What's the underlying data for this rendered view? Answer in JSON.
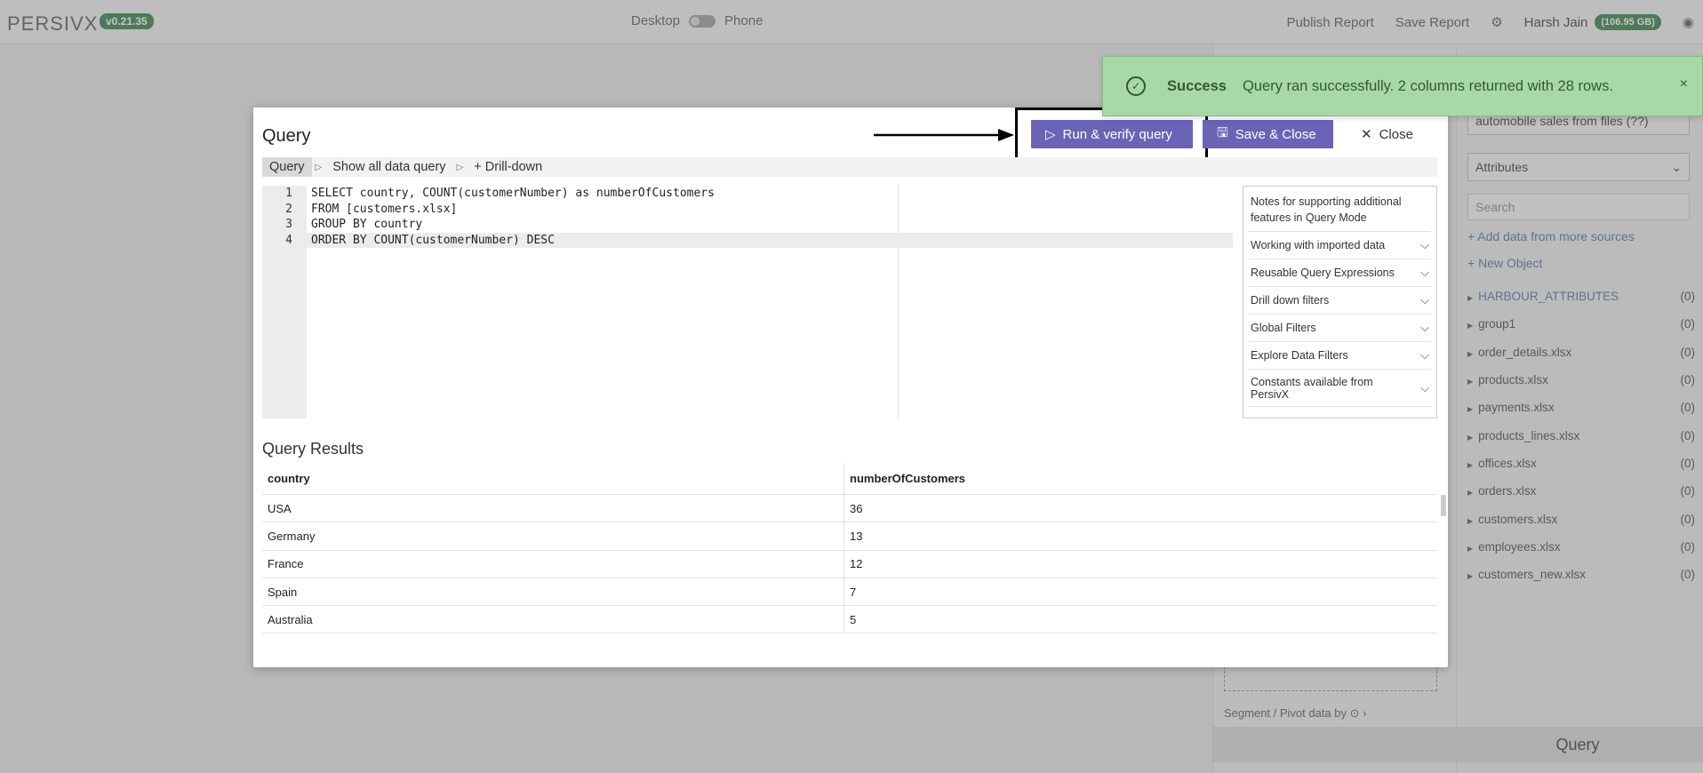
{
  "topbar": {
    "logo": "PERSIVX",
    "version": "v0.21.35",
    "desktop_label": "Desktop",
    "phone_label": "Phone",
    "publish_label": "Publish Report",
    "save_label": "Save Report",
    "user_name": "Harsh Jain",
    "storage": "(106.95 GB)"
  },
  "right_panel": {
    "datasource_select": "automobile sales from files (??)",
    "attributes_select": "Attributes",
    "search_placeholder": "Search",
    "add_data_link": "Add data from more sources",
    "new_object_link": "New Object",
    "items": [
      {
        "label": "HARBOUR_ATTRIBUTES",
        "count": "(0)"
      },
      {
        "label": "group1",
        "count": "(0)"
      },
      {
        "label": "order_details.xlsx",
        "count": "(0)"
      },
      {
        "label": "products.xlsx",
        "count": "(0)"
      },
      {
        "label": "payments.xlsx",
        "count": "(0)"
      },
      {
        "label": "products_lines.xlsx",
        "count": "(0)"
      },
      {
        "label": "offices.xlsx",
        "count": "(0)"
      },
      {
        "label": "orders.xlsx",
        "count": "(0)"
      },
      {
        "label": "customers.xlsx",
        "count": "(0)"
      },
      {
        "label": "employees.xlsx",
        "count": "(0)"
      },
      {
        "label": "customers_new.xlsx",
        "count": "(0)"
      }
    ],
    "segment_label": "Segment / Pivot data by",
    "query_button": "Query"
  },
  "modal": {
    "title": "Query",
    "run_label": "Run & verify query",
    "save_close_label": "Save & Close",
    "close_label": "Close",
    "tabs": [
      "Query",
      "Show all data query",
      "Drill-down"
    ],
    "code_lines": [
      "SELECT country, COUNT(customerNumber) as numberOfCustomers",
      "FROM [customers.xlsx]",
      "GROUP BY country",
      "ORDER BY COUNT(customerNumber) DESC"
    ],
    "line_numbers": [
      "1",
      "2",
      "3",
      "4"
    ],
    "notes_header": "Notes for supporting additional features in Query Mode",
    "notes": [
      "Working with imported data",
      "Reusable Query Expressions",
      "Drill down filters",
      "Global Filters",
      "Explore Data Filters",
      "Constants available from PersivX"
    ],
    "results_title": "Query Results",
    "columns": [
      "country",
      "numberOfCustomers"
    ],
    "rows": [
      [
        "USA",
        "36"
      ],
      [
        "Germany",
        "13"
      ],
      [
        "France",
        "12"
      ],
      [
        "Spain",
        "7"
      ],
      [
        "Australia",
        "5"
      ]
    ]
  },
  "toast": {
    "title": "Success",
    "message": "Query ran successfully. 2 columns returned with 28 rows.",
    "close": "×"
  }
}
